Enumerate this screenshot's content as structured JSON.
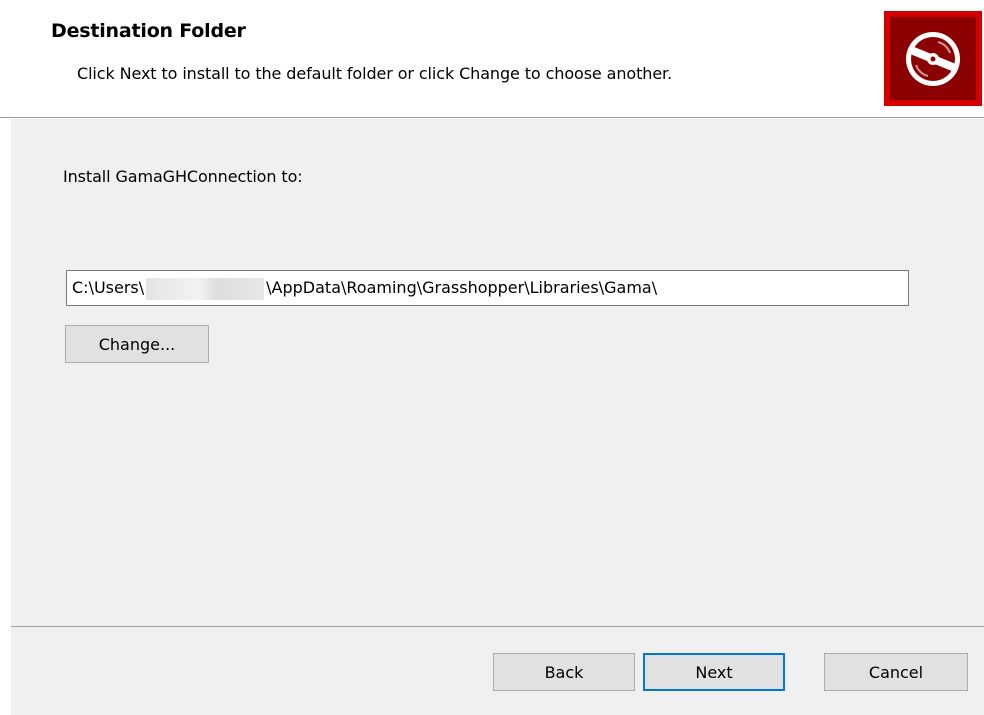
{
  "header": {
    "title": "Destination Folder",
    "subtitle": "Click Next to install to the default folder or click Change to choose another.",
    "logo_icon": "installer-disc-icon",
    "logo_color": "#d40000"
  },
  "main": {
    "install_label": "Install GamaGHConnection to:",
    "path_prefix": "C:\\Users\\",
    "path_suffix": "\\AppData\\Roaming\\Grasshopper\\Libraries\\Gama\\",
    "change_label": "Change..."
  },
  "footer": {
    "back_label": "Back",
    "next_label": "Next",
    "cancel_label": "Cancel",
    "default_button_color": "#0078d7"
  }
}
